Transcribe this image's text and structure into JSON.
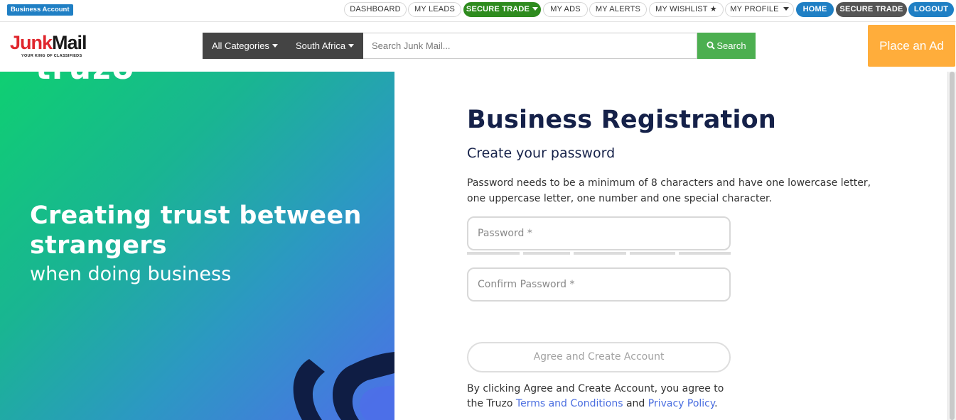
{
  "topbar": {
    "business_badge": "Business Account",
    "nav": [
      {
        "label": "DASHBOARD"
      },
      {
        "label": "MY LEADS"
      },
      {
        "label": "SECURE TRADE"
      },
      {
        "label": "MY ADS"
      },
      {
        "label": "MY ALERTS"
      },
      {
        "label": "MY WISHLIST"
      },
      {
        "label": "MY PROFILE"
      },
      {
        "label": "HOME"
      },
      {
        "label": "SECURE TRADE"
      },
      {
        "label": "LOGOUT"
      }
    ],
    "wishlist_star": "★"
  },
  "header": {
    "logo_junk": "Junk",
    "logo_mail": "Mail",
    "logo_tagline": "YOUR KING OF CLASSIFIEDS",
    "category_label": "All Categories",
    "region_label": "South Africa",
    "search_placeholder": "Search Junk Mail...",
    "search_button": "Search",
    "place_ad": "Place an Ad"
  },
  "hero": {
    "brand_fragment": "truzo",
    "headline": "Creating trust between strangers",
    "subheadline": "when doing business"
  },
  "form": {
    "title": "Business Registration",
    "subtitle": "Create your password",
    "description": "Password needs to be a minimum of 8 characters and have one lowercase letter, one uppercase letter, one number and one special character.",
    "password_placeholder": "Password *",
    "confirm_placeholder": "Confirm Password *",
    "submit_label": "Agree and Create Account",
    "terms_prefix": "By clicking Agree and Create Account, you agree to the Truzo ",
    "terms_link": "Terms and Conditions",
    "terms_and": " and ",
    "privacy_link": "Privacy Policy",
    "terms_suffix": "."
  },
  "colors": {
    "brand_red": "#e0262d",
    "secure_trade_green": "#2e8b1e",
    "nav_blue": "#1f7fc4",
    "search_green": "#4caf50",
    "place_ad_orange": "#ffad3b",
    "title_navy": "#152149",
    "link_blue": "#4a6ee0"
  }
}
